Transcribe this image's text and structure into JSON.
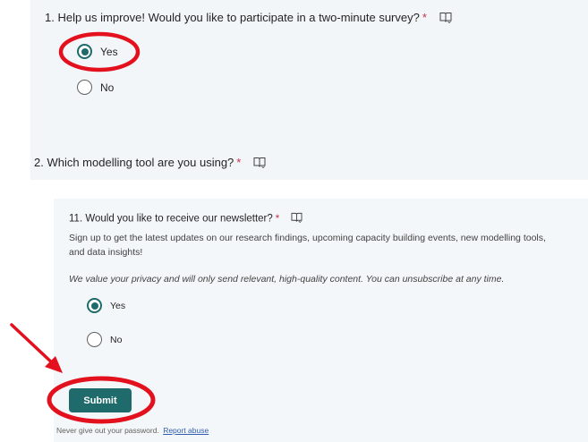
{
  "questions": [
    {
      "title": "1. Help us improve! Would you like to participate in a two-minute survey?",
      "required_mark": "*",
      "reader_icon": "immersive-reader-icon",
      "options": [
        {
          "label": "Yes",
          "selected": true
        },
        {
          "label": "No",
          "selected": false
        }
      ]
    },
    {
      "title": "2. Which modelling tool are you using?",
      "required_mark": "*",
      "reader_icon": "immersive-reader-icon"
    },
    {
      "title": "11. Would you like to receive our newsletter?",
      "required_mark": "*",
      "reader_icon": "immersive-reader-icon",
      "description_line1": "Sign up to get the latest updates on our research findings, upcoming capacity building events, new modelling tools,",
      "description_line2": "and data insights!",
      "privacy_note": "We value your privacy and will only send relevant, high-quality content. You can unsubscribe at any time.",
      "options": [
        {
          "label": "Yes",
          "selected": true
        },
        {
          "label": "No",
          "selected": false
        }
      ]
    }
  ],
  "submit_label": "Submit",
  "footer": {
    "text": "Never give out your password.",
    "link": "Report abuse"
  },
  "colors": {
    "accent": "#1f6b6b",
    "annotation": "#e3101e",
    "required": "#c4314b",
    "panel": "#f3f6f8"
  }
}
